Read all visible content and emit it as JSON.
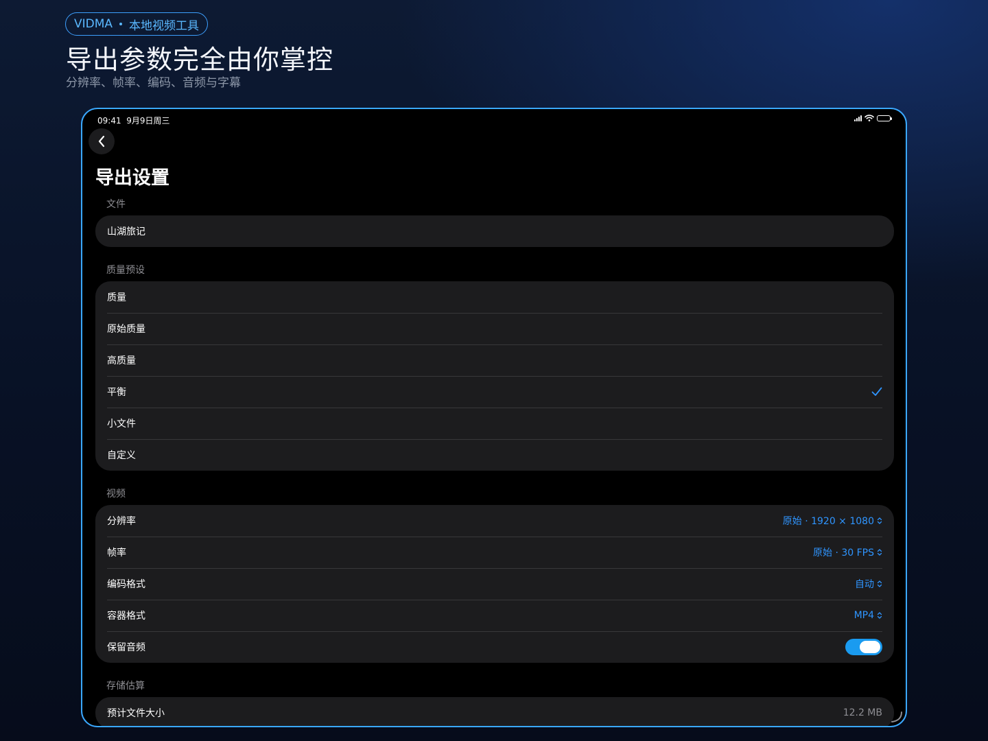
{
  "banner": {
    "brand": "VIDMA",
    "tagline": "本地视频工具",
    "title": "导出参数完全由你掌控",
    "subtitle": "分辨率、帧率、编码、音频与字幕"
  },
  "status_bar": {
    "time": "09:41",
    "date": "9月9日周三",
    "battery_level": 1.0
  },
  "page": {
    "title": "导出设置"
  },
  "sections": {
    "file": {
      "header": "文件",
      "filename": "山湖旅记"
    },
    "preset": {
      "header": "质量预设",
      "items": [
        "质量",
        "原始质量",
        "高质量",
        "平衡",
        "小文件",
        "自定义"
      ],
      "selected": "平衡"
    },
    "video": {
      "header": "视频",
      "resolution": {
        "label": "分辨率",
        "value": "原始 · 1920 × 1080"
      },
      "framerate": {
        "label": "帧率",
        "value": "原始 · 30 FPS"
      },
      "codec": {
        "label": "编码格式",
        "value": "自动"
      },
      "container": {
        "label": "容器格式",
        "value": "MP4"
      },
      "keep_audio": {
        "label": "保留音频",
        "on": true
      }
    },
    "storage": {
      "header": "存储估算",
      "estimate": {
        "label": "预计文件大小",
        "value": "12.2 MB"
      }
    }
  },
  "colors": {
    "accent": "#2f95ff",
    "toggle_on": "#1a9bf0",
    "device_border": "#3aa8ff"
  }
}
